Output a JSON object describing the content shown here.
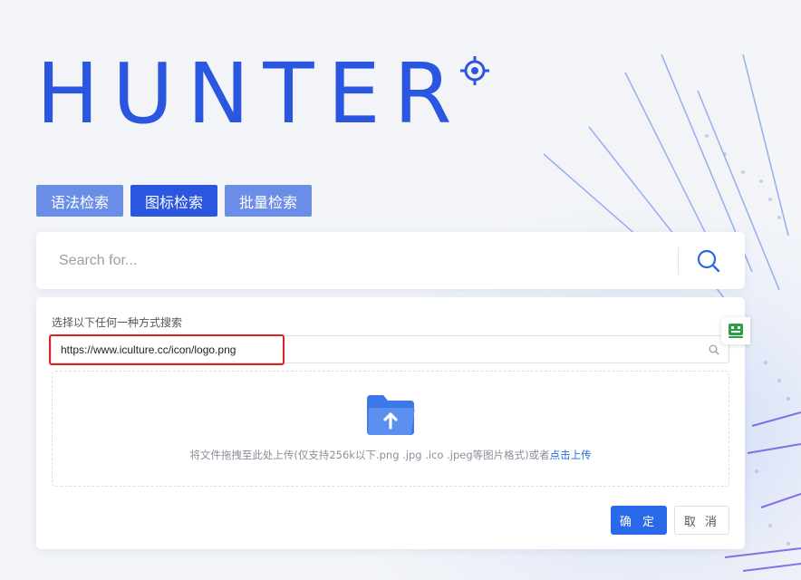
{
  "app": {
    "logo_text": "HUNTER"
  },
  "tabs": [
    {
      "label": "语法检索",
      "active": false
    },
    {
      "label": "图标检索",
      "active": true
    },
    {
      "label": "批量检索",
      "active": false
    }
  ],
  "search": {
    "placeholder": "Search for..."
  },
  "panel": {
    "label": "选择以下任何一种方式搜索",
    "url_value": "https://www.iculture.cc/icon/logo.png",
    "dropzone_text": "将文件拖拽至此处上传(仅支持256k以下.png .jpg .ico .jpeg等图片格式)或者",
    "dropzone_link": "点击上传",
    "confirm_label": "确 定",
    "cancel_label": "取 消"
  },
  "colors": {
    "brand": "#2a56e0",
    "tab_inactive": "#6a8ee8",
    "highlight": "#e02020"
  },
  "icons": {
    "logo": "crosshair-target-icon",
    "search": "search-icon",
    "url_search": "search-icon",
    "upload": "folder-upload-icon",
    "widget": "assistant-robot-icon"
  }
}
